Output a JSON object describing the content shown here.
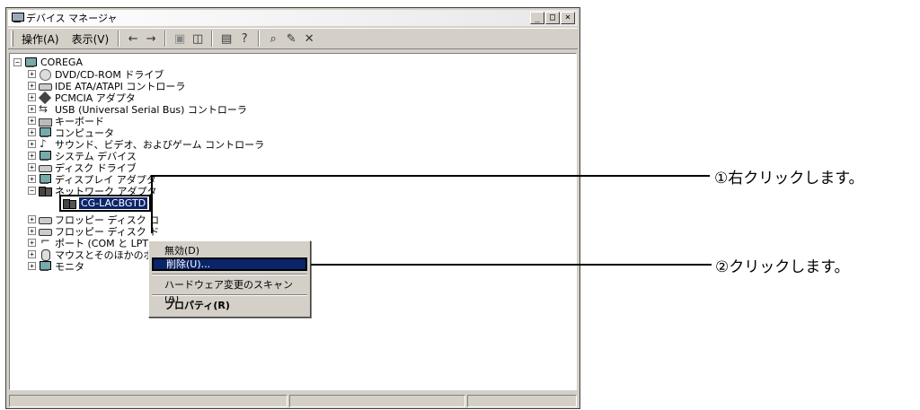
{
  "window": {
    "title": "デバイス マネージャ",
    "buttons": {
      "minimize": "_",
      "maximize": "□",
      "close": "×"
    }
  },
  "toolbar": {
    "menu_action": "操作(A)",
    "menu_view": "表示(V)",
    "icons": [
      "back-icon",
      "forward-icon",
      "properties-pane-icon",
      "view-icon",
      "properties-icon",
      "help-icon",
      "scan-icon",
      "uninstall-icon",
      "disable-icon"
    ]
  },
  "tree": {
    "root": "COREGA",
    "items": [
      "DVD/CD-ROM ドライブ",
      "IDE ATA/ATAPI コントローラ",
      "PCMCIA アダプタ",
      "USB (Universal Serial Bus) コントローラ",
      "キーボード",
      "コンピュータ",
      "サウンド、ビデオ、およびゲーム コントローラ",
      "システム デバイス",
      "ディスク ドライブ",
      "ディスプレイ アダプタ",
      "ネットワーク アダプタ",
      "CG-LACBGTD",
      "フロッピー ディスク コ",
      "フロッピー ディスク ド",
      "ポート (COM と LPT",
      "マウスとそのほかのポ",
      "モニタ"
    ]
  },
  "context_menu": {
    "disable": "無効(D)",
    "uninstall": "削除(U)...",
    "scan": "ハードウェア変更のスキャン(A)",
    "properties": "プロパティ(R)"
  },
  "callouts": {
    "first": "①右クリックします。",
    "second": "②クリックします。"
  }
}
